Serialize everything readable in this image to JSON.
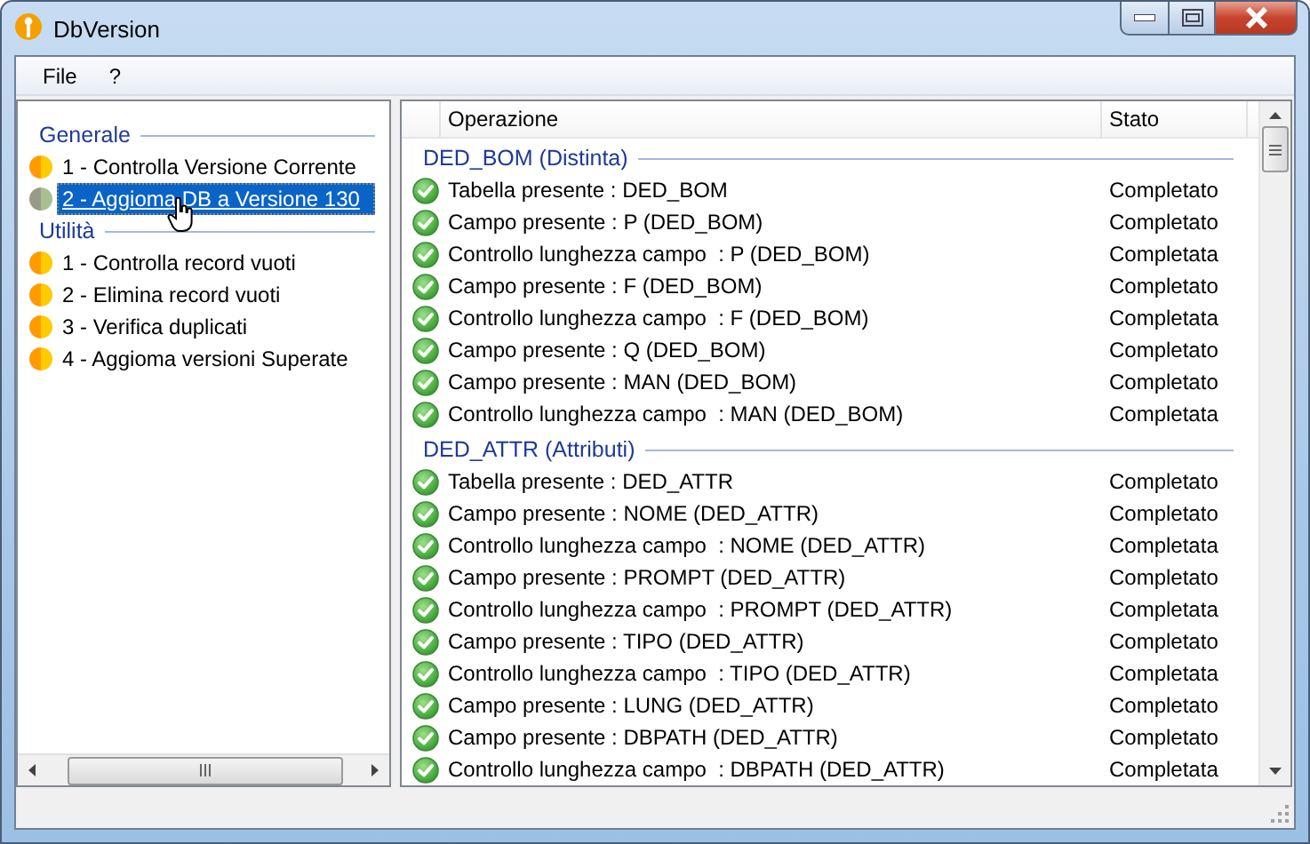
{
  "window": {
    "title": "DbVersion"
  },
  "menu": [
    "File",
    "?"
  ],
  "sidebar": {
    "groups": [
      {
        "title": "Generale",
        "items": [
          {
            "label": "1 - Controlla Versione Corrente",
            "kind": "pending",
            "selected": false
          },
          {
            "label": "2 - Aggioma DB a Versione 130",
            "kind": "active",
            "selected": true
          }
        ]
      },
      {
        "title": "Utilità",
        "items": [
          {
            "label": "1 - Controlla record vuoti",
            "kind": "pending",
            "selected": false
          },
          {
            "label": "2 - Elimina record vuoti",
            "kind": "pending",
            "selected": false
          },
          {
            "label": "3 - Verifica duplicati",
            "kind": "pending",
            "selected": false
          },
          {
            "label": "4 - Aggioma versioni Superate",
            "kind": "pending",
            "selected": false
          }
        ]
      }
    ]
  },
  "table": {
    "columns": [
      "Operazione",
      "Stato"
    ],
    "groups": [
      {
        "title": "DED_BOM (Distinta)",
        "rows": [
          {
            "operation": "Tabella presente : DED_BOM",
            "status": "Completato",
            "kind": "ok"
          },
          {
            "operation": "Campo presente : P (DED_BOM)",
            "status": "Completato",
            "kind": "ok"
          },
          {
            "operation": "Controllo lunghezza campo  : P (DED_BOM)",
            "status": "Completata",
            "kind": "ok"
          },
          {
            "operation": "Campo presente : F (DED_BOM)",
            "status": "Completato",
            "kind": "ok"
          },
          {
            "operation": "Controllo lunghezza campo  : F (DED_BOM)",
            "status": "Completata",
            "kind": "ok"
          },
          {
            "operation": "Campo presente : Q (DED_BOM)",
            "status": "Completato",
            "kind": "ok"
          },
          {
            "operation": "Campo presente : MAN (DED_BOM)",
            "status": "Completato",
            "kind": "ok"
          },
          {
            "operation": "Controllo lunghezza campo  : MAN (DED_BOM)",
            "status": "Completata",
            "kind": "ok"
          }
        ]
      },
      {
        "title": "DED_ATTR (Attributi)",
        "rows": [
          {
            "operation": "Tabella presente : DED_ATTR",
            "status": "Completato",
            "kind": "ok"
          },
          {
            "operation": "Campo presente : NOME (DED_ATTR)",
            "status": "Completato",
            "kind": "ok"
          },
          {
            "operation": "Controllo lunghezza campo  : NOME (DED_ATTR)",
            "status": "Completata",
            "kind": "ok"
          },
          {
            "operation": "Campo presente : PROMPT (DED_ATTR)",
            "status": "Completato",
            "kind": "ok"
          },
          {
            "operation": "Controllo lunghezza campo  : PROMPT (DED_ATTR)",
            "status": "Completata",
            "kind": "ok"
          },
          {
            "operation": "Campo presente : TIPO (DED_ATTR)",
            "status": "Completato",
            "kind": "ok"
          },
          {
            "operation": "Controllo lunghezza campo  : TIPO (DED_ATTR)",
            "status": "Completata",
            "kind": "ok"
          },
          {
            "operation": "Campo presente : LUNG (DED_ATTR)",
            "status": "Completato",
            "kind": "ok"
          },
          {
            "operation": "Campo presente : DBPATH (DED_ATTR)",
            "status": "Completato",
            "kind": "ok"
          },
          {
            "operation": "Controllo lunghezza campo  : DBPATH (DED_ATTR)",
            "status": "Completata",
            "kind": "ok"
          }
        ]
      }
    ]
  }
}
